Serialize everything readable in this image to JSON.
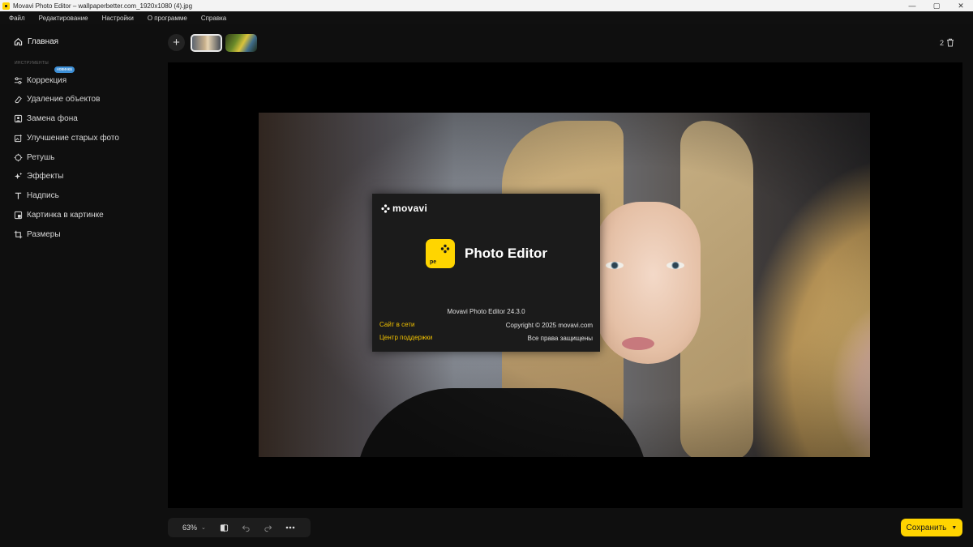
{
  "window": {
    "title": "Movavi Photo Editor – wallpaperbetter.com_1920x1080 (4).jpg",
    "controls": [
      "—",
      "▢",
      "✕"
    ]
  },
  "menu": [
    "Файл",
    "Редактирование",
    "Настройки",
    "О программе",
    "Справка"
  ],
  "sidebar": {
    "home_label": "Главная",
    "section_label": "ИНСТРУМЕНТЫ",
    "new_badge": "НОВИНКА",
    "tools": [
      {
        "label": "Коррекция",
        "icon": "sliders-icon"
      },
      {
        "label": "Удаление объектов",
        "icon": "eraser-icon"
      },
      {
        "label": "Замена фона",
        "icon": "portrait-icon"
      },
      {
        "label": "Улучшение старых фото",
        "icon": "photo-enhance-icon"
      },
      {
        "label": "Ретушь",
        "icon": "retouch-icon"
      },
      {
        "label": "Эффекты",
        "icon": "sparkle-icon"
      },
      {
        "label": "Надпись",
        "icon": "text-icon"
      },
      {
        "label": "Картинка в картинке",
        "icon": "picture-in-picture-icon"
      },
      {
        "label": "Размеры",
        "icon": "crop-icon"
      }
    ]
  },
  "topbar": {
    "add_label": "+",
    "open_count": "2"
  },
  "about": {
    "brand": "movavi",
    "logo_text": "pe",
    "product": "Photo Editor",
    "version": "Movavi Photo Editor 24.3.0",
    "link_site": "Сайт в сети",
    "link_support": "Центр поддержки",
    "copyright": "Copyright © 2025 movavi.com",
    "rights": "Все права защищены"
  },
  "bottombar": {
    "zoom": "63%",
    "zoom_caret": "⌄",
    "save_label": "Сохранить"
  },
  "colors": {
    "accent": "#ffd400",
    "link": "#f2c200",
    "badge": "#3d8fd6",
    "background": "#0f0f0f"
  }
}
